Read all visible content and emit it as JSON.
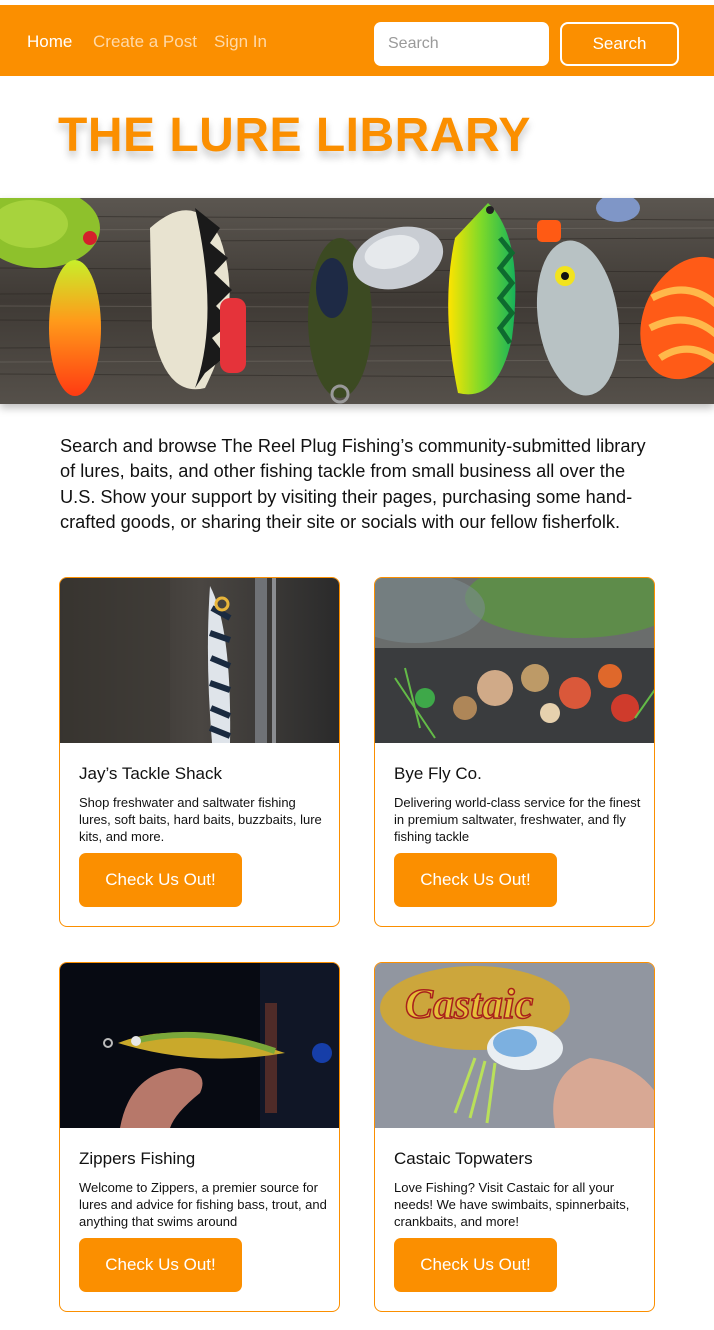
{
  "nav": {
    "links": [
      "Home",
      "Create a Post",
      "Sign In"
    ],
    "search_placeholder": "Search",
    "search_button": "Search"
  },
  "title": "THE LURE LIBRARY",
  "intro": "Search and browse The Reel Plug Fishing’s community-submitted library of lures, baits, and other fishing tackle from small business all over the U.S. Show your support by visiting their pages, purchasing some hand-crafted goods, or sharing their site or socials with our fellow fisherfolk.",
  "cards": [
    {
      "title": "Jay’s Tackle Shack",
      "desc": "Shop freshwater and saltwater fishing lures, soft baits, hard baits, buzzbaits, lure kits, and more.",
      "button": "Check Us Out!"
    },
    {
      "title": "Bye Fly Co.",
      "desc": "Delivering world-class service for the finest in premium saltwater, freshwater, and fly fishing tackle",
      "button": "Check Us Out!"
    },
    {
      "title": "Zippers Fishing",
      "desc": "Welcome to Zippers, a premier source for lures and advice for fishing bass, trout, and anything that swims around",
      "button": "Check Us Out!"
    },
    {
      "title": "Castaic Topwaters",
      "desc": "Love Fishing? Visit Castaic for all your needs! We have swimbaits, spinnerbaits, crankbaits, and more!",
      "button": "Check Us Out!",
      "image_text": "Castaic"
    }
  ],
  "colors": {
    "accent": "#fb8f00",
    "text": "#111111",
    "background": "#ffffff"
  }
}
